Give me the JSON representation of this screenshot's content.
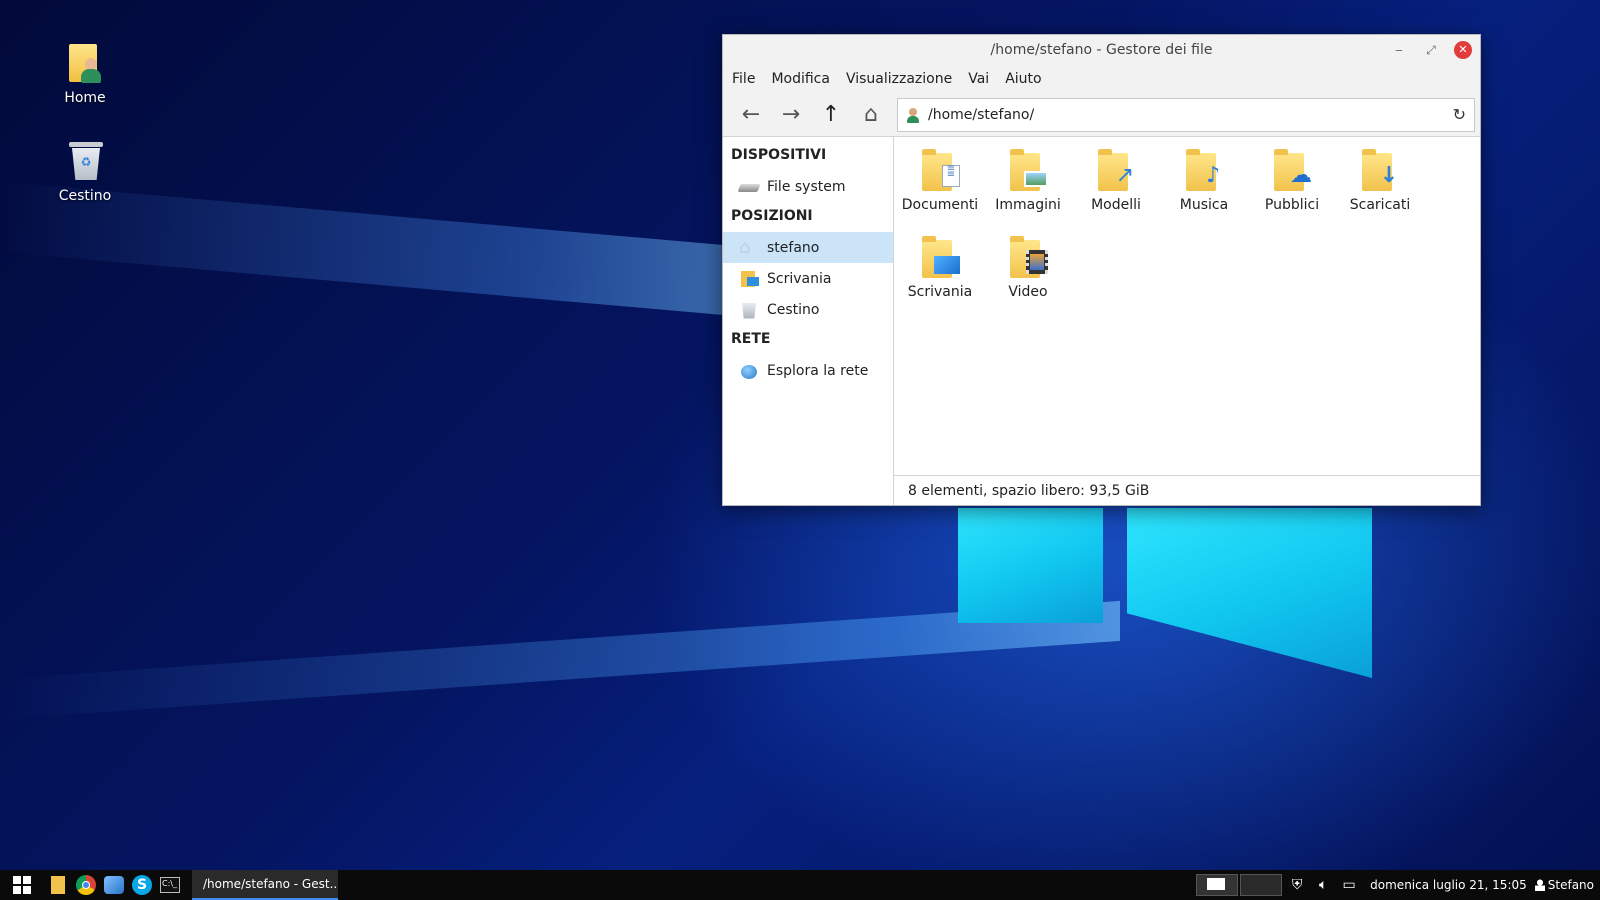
{
  "desktop": {
    "icons": [
      {
        "label": "Home"
      },
      {
        "label": "Cestino"
      }
    ]
  },
  "window": {
    "title": "/home/stefano - Gestore dei file",
    "menu": [
      "File",
      "Modifica",
      "Visualizzazione",
      "Vai",
      "Aiuto"
    ],
    "address": "/home/stefano/",
    "sidebar": {
      "devices_header": "DISPOSITIVI",
      "devices": [
        {
          "label": "File system",
          "icon": "drive-icon"
        }
      ],
      "places_header": "POSIZIONI",
      "places": [
        {
          "label": "stefano",
          "icon": "home-icon",
          "selected": true
        },
        {
          "label": "Scrivania",
          "icon": "desktop-folder-icon"
        },
        {
          "label": "Cestino",
          "icon": "trash-icon"
        }
      ],
      "network_header": "RETE",
      "network": [
        {
          "label": "Esplora la rete",
          "icon": "network-icon"
        }
      ]
    },
    "folders": [
      {
        "label": "Documenti",
        "icon": "documents-folder-icon"
      },
      {
        "label": "Immagini",
        "icon": "pictures-folder-icon"
      },
      {
        "label": "Modelli",
        "icon": "templates-folder-icon"
      },
      {
        "label": "Musica",
        "icon": "music-folder-icon"
      },
      {
        "label": "Pubblici",
        "icon": "public-folder-icon"
      },
      {
        "label": "Scaricati",
        "icon": "downloads-folder-icon"
      },
      {
        "label": "Scrivania",
        "icon": "desktop-folder-icon"
      },
      {
        "label": "Video",
        "icon": "videos-folder-icon"
      }
    ],
    "status": "8 elementi, spazio libero: 93,5 GiB"
  },
  "taskbar": {
    "task_label": "/home/stefano - Gest...",
    "clock": "domenica luglio 21, 15:05",
    "user": "Stefano"
  }
}
